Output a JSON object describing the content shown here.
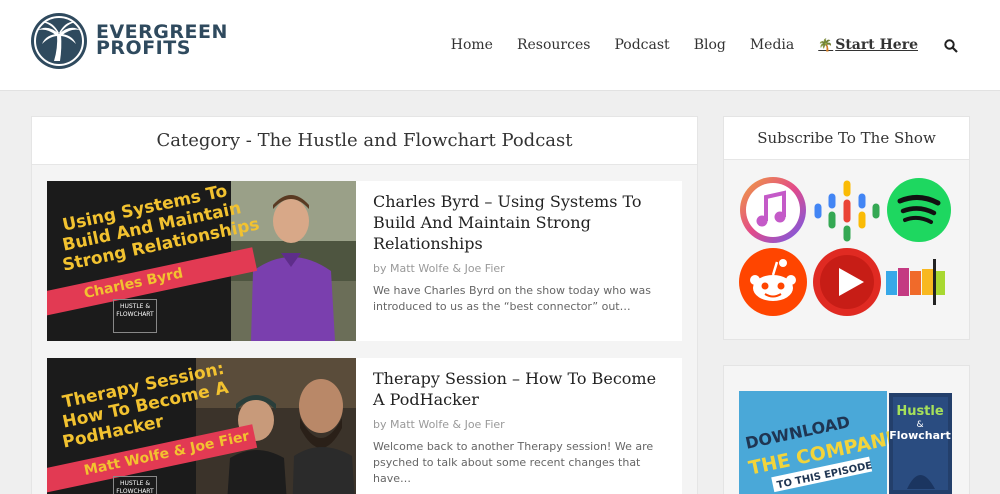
{
  "brand": {
    "line1": "EVERGREEN",
    "line2": "PROFITS"
  },
  "nav": {
    "items": [
      "Home",
      "Resources",
      "Podcast",
      "Blog",
      "Media"
    ],
    "start_label": "Start Here",
    "start_icon": "palm-tree-icon",
    "search_icon": "search-icon"
  },
  "category": {
    "title": "Category - The Hustle and Flowchart Podcast"
  },
  "posts": [
    {
      "title": "Charles Byrd – Using Systems To Build And Maintain Strong Relationships",
      "meta": "by Matt Wolfe & Joe Fier",
      "excerpt": "We have Charles Byrd on the show today who was introduced to us as the “best connector” out…",
      "thumb_lines": [
        "Using Systems To",
        "Build And Maintain",
        "Strong Relationships"
      ],
      "thumb_band": "Charles Byrd",
      "thumb_badge": "HUSTLE & FLOWCHART"
    },
    {
      "title": "Therapy Session – How To Become A PodHacker",
      "meta": "by Matt Wolfe & Joe Fier",
      "excerpt": "Welcome back to another Therapy session! We are psyched to talk about some recent changes that have…",
      "thumb_lines": [
        "Therapy Session:",
        "How To Become A",
        "PodHacker"
      ],
      "thumb_band": "Matt Wolfe & Joe Fier",
      "thumb_badge": "HUSTLE & FLOWCHART"
    }
  ],
  "sidebar": {
    "subscribe_title": "Subscribe To The Show",
    "platforms": [
      "apple-podcasts-icon",
      "google-podcasts-icon",
      "spotify-icon",
      "reddit-icon",
      "youtube-icon",
      "stitcher-icon"
    ],
    "promo": {
      "line1": "DOWNLOAD",
      "line2": "THE COMPANION",
      "line3": "TO THIS EPISODE",
      "book_title1": "Hustle",
      "book_amp": "&",
      "book_title2": "Flowchart"
    }
  },
  "colors": {
    "brand": "#2f4a5e",
    "accent_yellow": "#f2c230",
    "accent_red": "#e23a53",
    "promo_blue": "#4aa8d8"
  }
}
